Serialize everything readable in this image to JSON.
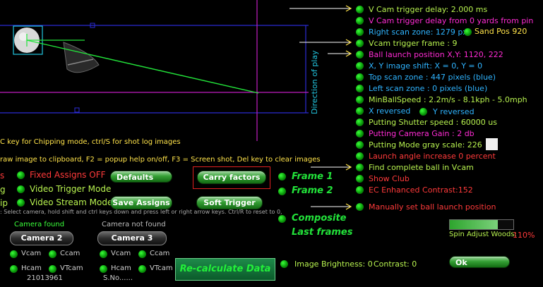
{
  "top_view": {
    "direction_label": "Direction of play",
    "help_line_1": "C key for Chipping mode, ctrl/S for shot log images",
    "help_line_2": "raw image to clipboard, F2 = popup help on/off, F3 = Screen shot, Del key to clear images",
    "help_line_3": ": Select camera, hold shift and ctrl keys down and press left or right arrow keys. Ctrl/R to reset to 0,1,2,3"
  },
  "left_controls": {
    "fixed_assigns_label": "Fixed Assigns OFF",
    "fixed_assigns_prefix": "s",
    "video_trigger_label": "Video Trigger Mode",
    "video_trigger_prefix": "g",
    "video_stream_label": "Video Stream Mode",
    "video_stream_prefix": "ip"
  },
  "buttons": {
    "defaults": "Defaults",
    "carry_factors": "Carry factors",
    "save_assigns": "Save Assigns",
    "soft_trigger": "Soft Trigger",
    "recalculate": "Re-calculate Data",
    "ok": "Ok"
  },
  "frames": {
    "frame1": "Frame 1",
    "frame2": "Frame 2",
    "composite": "Composite",
    "last_frames": "Last frames"
  },
  "cameras": {
    "left": {
      "status": "Camera found",
      "name": "Camera 2",
      "vcam": "Vcam",
      "ccam": "Ccam",
      "hcam": "Hcam",
      "vtcam": "VTcam",
      "serial": "21013961"
    },
    "right": {
      "status": "Camera not found",
      "name": "Camera 3",
      "vcam": "Vcam",
      "ccam": "Ccam",
      "hcam": "Hcam",
      "vtcam": "VTcam",
      "serial": "S.No......"
    }
  },
  "settings_list": [
    {
      "text": "V Cam trigger delay: 2.000 ms",
      "color": "#b7f24f"
    },
    {
      "text": "V Cam trigger delay from 0 yards from pin",
      "color": "#ff2bd4"
    },
    {
      "text": "Right scan zone: 1279 px",
      "color": "#2fb4ff"
    },
    {
      "text": "Vcam trigger frame : 9",
      "color": "#b7f24f"
    },
    {
      "text": "Ball launch position X,Y: 1120, 222",
      "color": "#ff2bd4"
    },
    {
      "text": "X, Y image shift: X = 0, Y = 0",
      "color": "#2fb4ff"
    },
    {
      "text": "Top scan zone : 447 pixels (blue)",
      "color": "#2fb4ff"
    },
    {
      "text": "Left scan zone : 0 pixels (blue)",
      "color": "#2fb4ff"
    },
    {
      "text": "MinBallSpeed : 2.2m/s - 8.1kph - 5.0mph",
      "color": "#b7f24f"
    },
    {
      "text": "X reversed",
      "color": "#2fb4ff"
    },
    {
      "text": "Putting Shutter speed : 60000 us",
      "color": "#b7f24f"
    },
    {
      "text": "Putting Camera Gain : 2 db",
      "color": "#ff2bd4"
    },
    {
      "text": "Putting Mode gray scale: 226",
      "color": "#b7f24f"
    },
    {
      "text": "Launch angle increase 0 percent",
      "color": "#ff3a3a"
    },
    {
      "text": "Find complete ball in Vcam",
      "color": "#b7f24f"
    },
    {
      "text": "Show Club",
      "color": "#ff3a3a"
    },
    {
      "text": "EC Enhanced Contrast:152",
      "color": "#ff3a3a"
    },
    {
      "text": "Manually set ball launch position",
      "color": "#ff3a3a"
    }
  ],
  "extra_labels": {
    "sand_pos": "Sand Pos 920",
    "y_reversed": "Y reversed"
  },
  "bottom": {
    "image_brightness": "Image Brightness: 0",
    "contrast": "Contrast: 0",
    "spin_adjust_label": "Spin Adjust Woods:",
    "spin_adjust_value": "110%",
    "spin_adjust_fraction": 0.75
  },
  "colors": {
    "green_text": "#b7f24f",
    "cyan_text": "#2fb4ff",
    "magenta_text": "#ff2bd4",
    "red_text": "#ff3a3a",
    "yellow_text": "#ffe34a",
    "frame_green": "#22e33a"
  }
}
